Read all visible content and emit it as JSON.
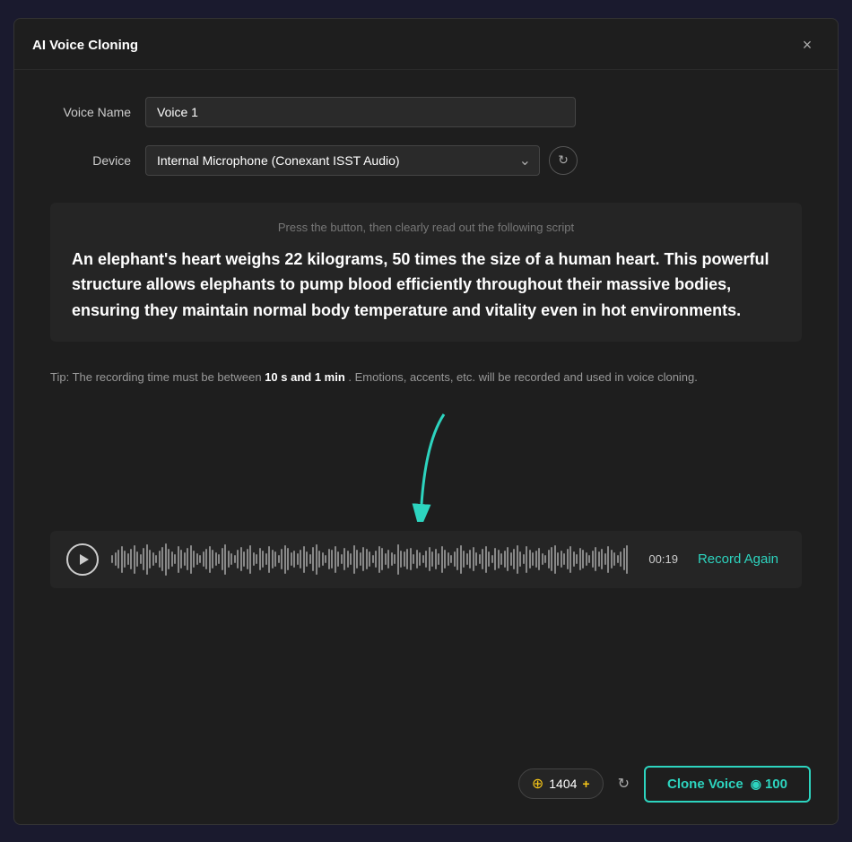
{
  "dialog": {
    "title": "AI Voice Cloning",
    "close_label": "×"
  },
  "form": {
    "voice_name_label": "Voice Name",
    "voice_name_value": "Voice 1",
    "voice_name_placeholder": "Voice 1",
    "device_label": "Device",
    "device_value": "Internal Microphone (Conexant ISST Audio)",
    "device_options": [
      "Internal Microphone (Conexant ISST Audio)"
    ]
  },
  "script": {
    "hint": "Press the button, then clearly read out the following script",
    "text": "An elephant's heart weighs 22 kilograms, 50 times the size of a human heart. This powerful structure allows elephants to pump blood efficiently throughout their massive bodies, ensuring they maintain normal body temperature and vitality even in hot environments."
  },
  "tip": {
    "prefix": "Tip: The recording time must be between ",
    "highlight": "10 s and 1 min",
    "suffix": " . Emotions, accents, etc. will be recorded and used in voice cloning."
  },
  "audio_player": {
    "time": "00:19",
    "record_again_label": "Record Again"
  },
  "footer": {
    "credits_amount": "1404",
    "credits_plus": "+",
    "clone_button_label": "Clone Voice",
    "clone_button_icon": "◉",
    "clone_cost": "100",
    "refresh_icon": "↻"
  },
  "icons": {
    "close": "✕",
    "play": "▶",
    "refresh": "↻",
    "chevron_down": "∨",
    "credits": "⊕"
  }
}
